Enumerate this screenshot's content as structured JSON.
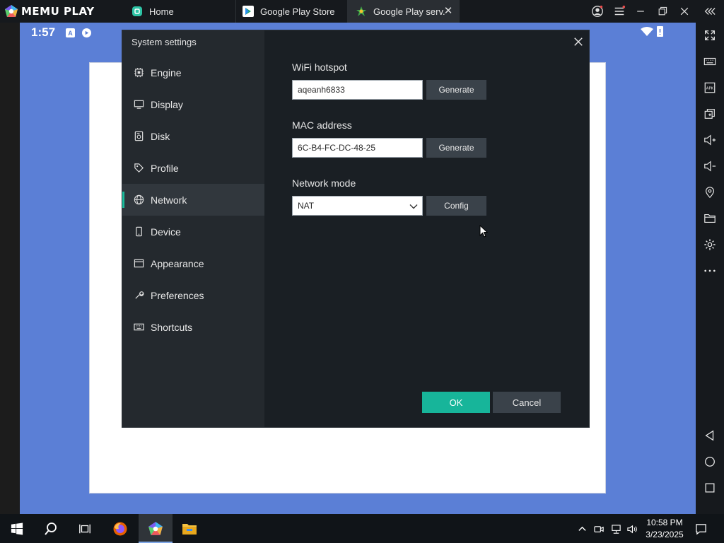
{
  "app": {
    "brand": "MEMU PLAY"
  },
  "tabs": [
    {
      "label": "Home",
      "icon": "home-app-icon"
    },
    {
      "label": "Google Play Store",
      "icon": "play-store-icon"
    },
    {
      "label": "Google Play serv.",
      "icon": "play-services-icon",
      "active": true
    }
  ],
  "android": {
    "time": "1:57",
    "status_icons": [
      "A",
      "shield"
    ]
  },
  "dialog": {
    "title": "System settings",
    "nav": [
      {
        "label": "Engine",
        "icon": "chip-icon"
      },
      {
        "label": "Display",
        "icon": "monitor-icon"
      },
      {
        "label": "Disk",
        "icon": "disk-icon"
      },
      {
        "label": "Profile",
        "icon": "tag-icon"
      },
      {
        "label": "Network",
        "icon": "globe-icon",
        "active": true
      },
      {
        "label": "Device",
        "icon": "phone-icon"
      },
      {
        "label": "Appearance",
        "icon": "window-icon"
      },
      {
        "label": "Preferences",
        "icon": "wrench-icon"
      },
      {
        "label": "Shortcuts",
        "icon": "keyboard-icon"
      }
    ],
    "wifi": {
      "label": "WiFi hotspot",
      "value": "aqeanh6833",
      "button": "Generate"
    },
    "mac": {
      "label": "MAC address",
      "value": "6C-B4-FC-DC-48-25",
      "button": "Generate"
    },
    "network_mode": {
      "label": "Network mode",
      "value": "NAT",
      "button": "Config"
    },
    "ok": "OK",
    "cancel": "Cancel"
  },
  "taskbar": {
    "time": "10:58 PM",
    "date": "3/23/2025"
  },
  "colors": {
    "accent": "#17b59a",
    "android_bg": "#5b7fd6",
    "dialog_bg": "#1a1f24"
  }
}
